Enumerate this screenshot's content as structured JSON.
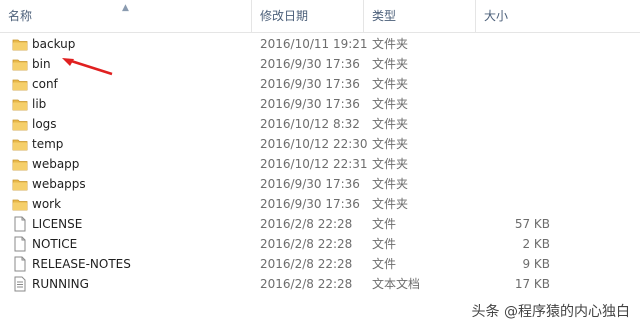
{
  "columns": {
    "name": "名称",
    "date": "修改日期",
    "type": "类型",
    "size": "大小"
  },
  "files": [
    {
      "name": "backup",
      "date": "2016/10/11 19:21",
      "type": "文件夹",
      "size": "",
      "icon": "folder-icon"
    },
    {
      "name": "bin",
      "date": "2016/9/30 17:36",
      "type": "文件夹",
      "size": "",
      "icon": "folder-icon"
    },
    {
      "name": "conf",
      "date": "2016/9/30 17:36",
      "type": "文件夹",
      "size": "",
      "icon": "folder-icon"
    },
    {
      "name": "lib",
      "date": "2016/9/30 17:36",
      "type": "文件夹",
      "size": "",
      "icon": "folder-icon"
    },
    {
      "name": "logs",
      "date": "2016/10/12 8:32",
      "type": "文件夹",
      "size": "",
      "icon": "folder-icon"
    },
    {
      "name": "temp",
      "date": "2016/10/12 22:30",
      "type": "文件夹",
      "size": "",
      "icon": "folder-icon"
    },
    {
      "name": "webapp",
      "date": "2016/10/12 22:31",
      "type": "文件夹",
      "size": "",
      "icon": "folder-icon"
    },
    {
      "name": "webapps",
      "date": "2016/9/30 17:36",
      "type": "文件夹",
      "size": "",
      "icon": "folder-icon"
    },
    {
      "name": "work",
      "date": "2016/9/30 17:36",
      "type": "文件夹",
      "size": "",
      "icon": "folder-icon"
    },
    {
      "name": "LICENSE",
      "date": "2016/2/8 22:28",
      "type": "文件",
      "size": "57 KB",
      "icon": "file-icon"
    },
    {
      "name": "NOTICE",
      "date": "2016/2/8 22:28",
      "type": "文件",
      "size": "2 KB",
      "icon": "file-icon"
    },
    {
      "name": "RELEASE-NOTES",
      "date": "2016/2/8 22:28",
      "type": "文件",
      "size": "9 KB",
      "icon": "file-icon"
    },
    {
      "name": "RUNNING",
      "date": "2016/2/8 22:28",
      "type": "文本文档",
      "size": "17 KB",
      "icon": "text-document-icon"
    }
  ],
  "watermark": "头条 @程序猿的内心独白",
  "colors": {
    "folder": "#e8b84a",
    "arrow": "#e02020",
    "header_text": "#4c607a"
  }
}
